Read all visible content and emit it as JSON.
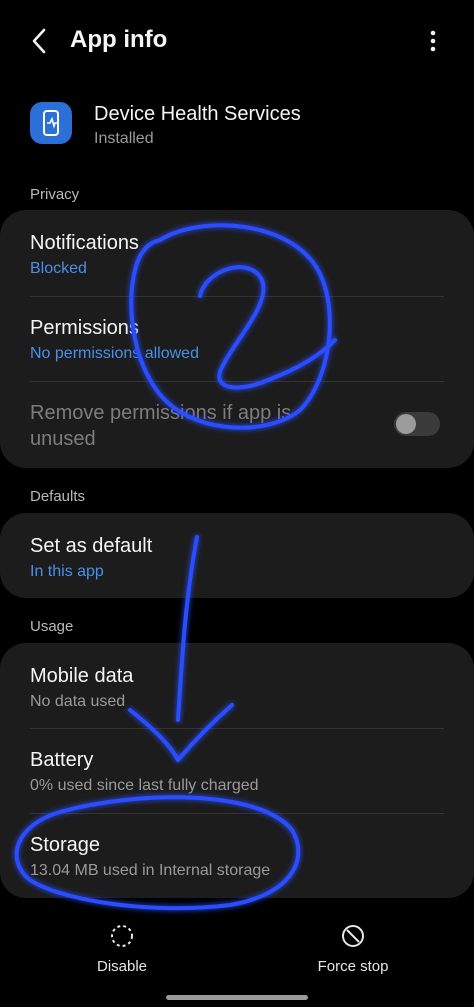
{
  "header": {
    "title": "App info",
    "back_icon": "back-arrow-icon",
    "menu_icon": "more-vert-icon"
  },
  "app": {
    "name": "Device Health Services",
    "status": "Installed",
    "icon": "device-health-icon",
    "icon_color": "#2c6fd6"
  },
  "sections": {
    "privacy": "Privacy",
    "defaults": "Defaults",
    "usage": "Usage"
  },
  "privacy": {
    "notifications": {
      "title": "Notifications",
      "subtitle": "Blocked"
    },
    "permissions": {
      "title": "Permissions",
      "subtitle": "No permissions allowed"
    },
    "remove_permissions": {
      "title_line1": "Remove permissions if app is",
      "title_line2": "unused",
      "enabled": false
    }
  },
  "defaults": {
    "set_as_default": {
      "title": "Set as default",
      "subtitle": "In this app"
    }
  },
  "usage": {
    "mobile_data": {
      "title": "Mobile data",
      "subtitle": "No data used"
    },
    "battery": {
      "title": "Battery",
      "subtitle": "0% used since last fully charged"
    },
    "storage": {
      "title": "Storage",
      "subtitle": "13.04 MB used in Internal storage"
    }
  },
  "bottom_bar": {
    "disable": {
      "label": "Disable",
      "icon": "dashed-circle-icon"
    },
    "force_stop": {
      "label": "Force stop",
      "icon": "stop-circle-icon"
    }
  },
  "colors": {
    "accent": "#4a8fe9",
    "annotation": "#2a4dff"
  }
}
